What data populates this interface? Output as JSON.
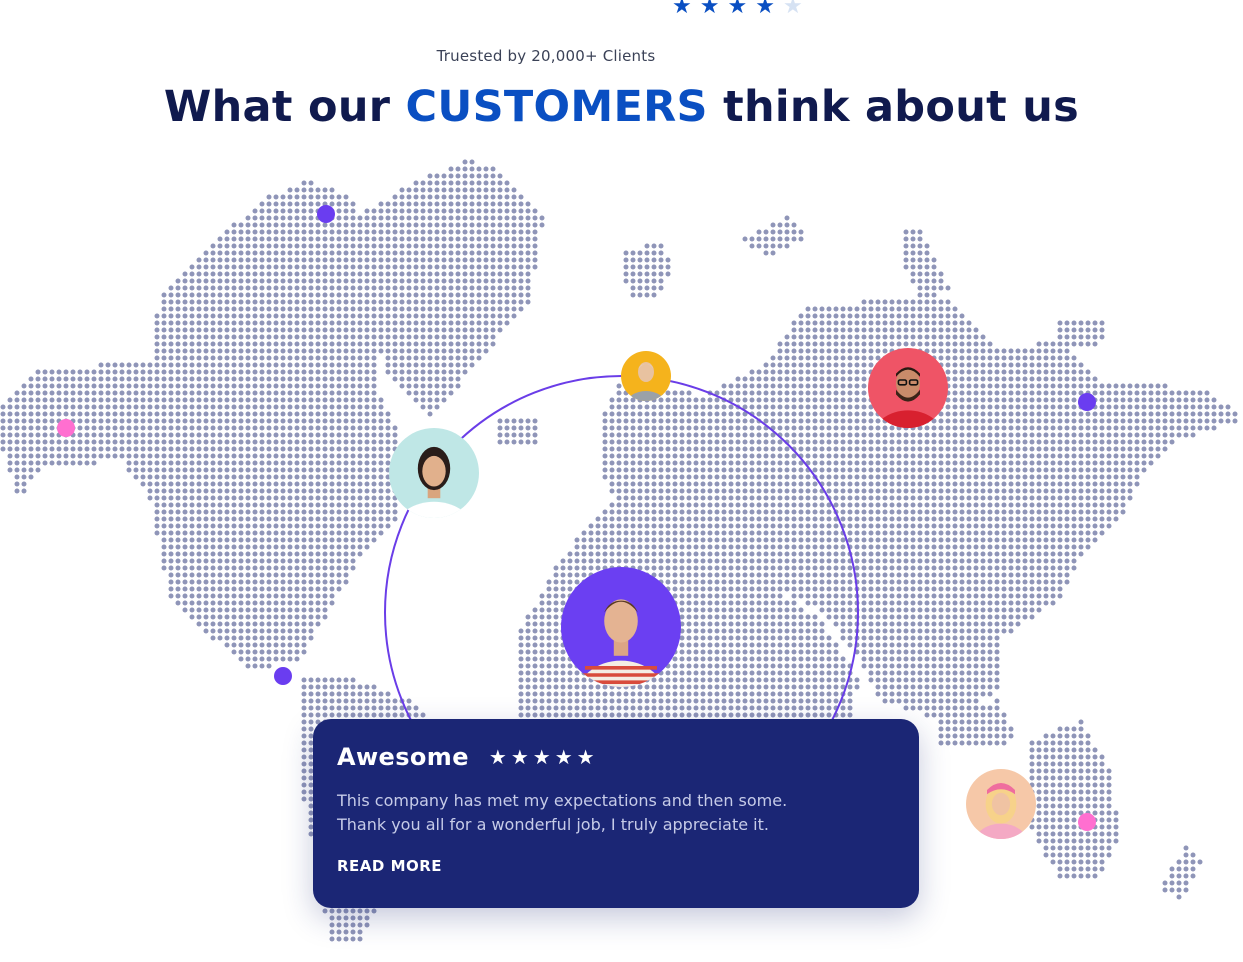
{
  "colors": {
    "navy": "#101a4e",
    "accent_blue": "#0a4fc2",
    "card_bg": "#1b2675",
    "orbit": "#6a3de8",
    "map_dots": "#8f95b8",
    "purple_dot": "#6a3df0",
    "pink_dot": "#ff6fd0",
    "star_filled": "#0a4fc2",
    "star_empty": "#d6e2f3"
  },
  "top_rating": {
    "stars_filled": 4,
    "stars_total": 5
  },
  "trust_line": "Truested by 20,000+ Clients",
  "headline": {
    "before": "What our",
    "highlight": "CUSTOMERS",
    "after": "think about us"
  },
  "avatars": [
    {
      "name": "customer-avatar-woman-teal"
    },
    {
      "name": "customer-avatar-older-man-yellow"
    },
    {
      "name": "customer-avatar-man-red"
    },
    {
      "name": "customer-avatar-man-purple-featured"
    },
    {
      "name": "customer-avatar-woman-pink"
    }
  ],
  "review": {
    "title": "Awesome",
    "rating": 5,
    "text_line_1": "This company has met my expectations and then some.",
    "text_line_2": "Thank you all for a wonderful job, I truly appreciate it.",
    "read_more": "READ MORE"
  },
  "icons": {
    "star": "star-icon"
  }
}
